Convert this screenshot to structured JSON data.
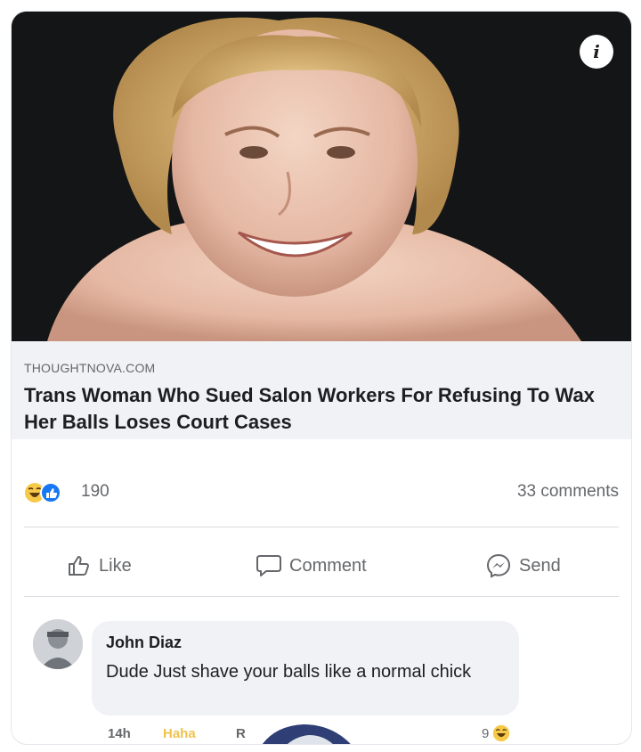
{
  "post": {
    "info_icon": "info-icon",
    "info_glyph": "i",
    "link": {
      "domain": "THOUGHTNOVA.COM",
      "headline": "Trans Woman Who Sued Salon Workers For Refusing To Wax Her Balls Loses Court Cases"
    },
    "reactions": {
      "icons": [
        "haha-reaction-icon",
        "like-reaction-icon"
      ],
      "count": "190",
      "comments": "33 comments"
    },
    "actions": [
      {
        "label": "Like",
        "icon": "thumbs-up-icon"
      },
      {
        "label": "Comment",
        "icon": "speech-bubble-icon"
      },
      {
        "label": "Send",
        "icon": "messenger-icon"
      }
    ]
  },
  "comment": {
    "author": "John Diaz",
    "text": "Dude  Just shave your balls like a normal chick",
    "time": "14h",
    "haha": "Haha",
    "reply": "R",
    "reaction_count": "9",
    "reaction_icon": "haha-reaction-icon"
  },
  "colors": {
    "accent_blue": "#1877f2",
    "haha_yellow": "#f7c948",
    "text_primary": "#1c1e21",
    "text_secondary": "#65676b",
    "preview_bg": "#f0f2f5"
  }
}
